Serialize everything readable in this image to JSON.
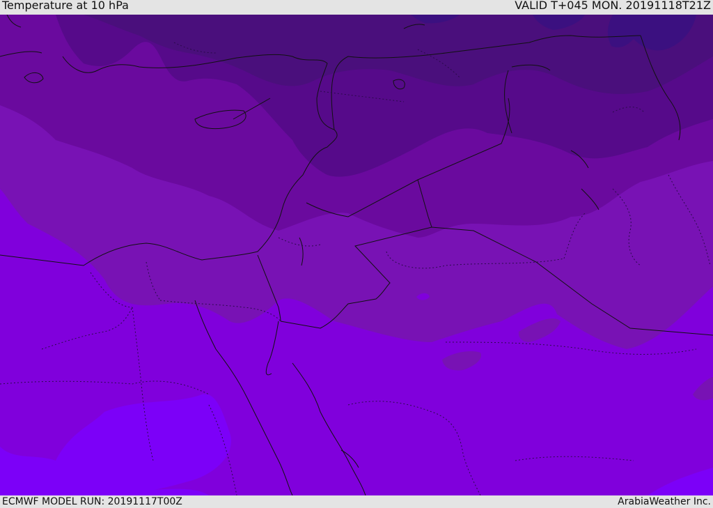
{
  "header": {
    "title": "Temperature at 10 hPa",
    "valid": "VALID T+045 MON. 20191118T21Z"
  },
  "footer": {
    "model_run": "ECMWF MODEL RUN: 20191117T00Z",
    "credit": "ArabiaWeather Inc."
  },
  "colors": {
    "band_darkest": "#4a0f7c",
    "band_dark": "#560a8a",
    "band_mid_dark": "#6a0a9e",
    "band_mid": "#7812b4",
    "band_light": "#8000dc",
    "band_lightest": "#7c00f8",
    "patch_deep": "#3b1080",
    "border_line": "#111111"
  }
}
